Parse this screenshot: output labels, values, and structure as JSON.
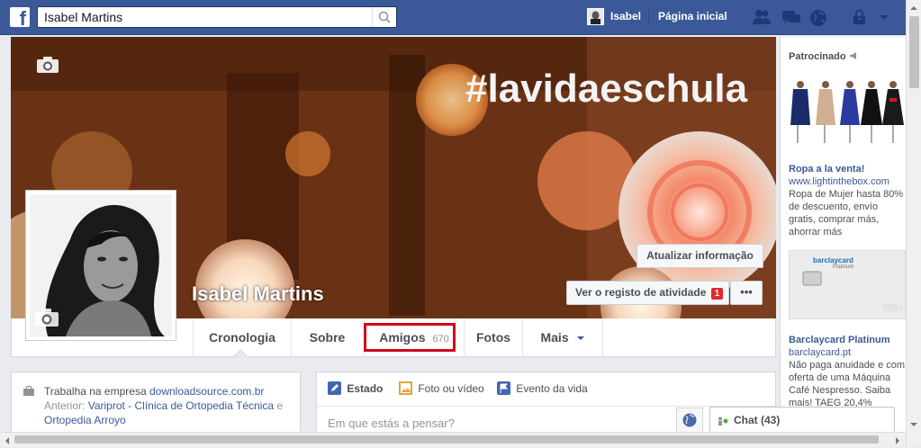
{
  "topbar": {
    "search_value": "Isabel Martins",
    "user_name": "Isabel",
    "home_label": "Página inicial",
    "icons": [
      "friend-requests-icon",
      "messages-icon",
      "notifications-globe-icon",
      "privacy-lock-icon",
      "account-dropdown-icon"
    ]
  },
  "cover": {
    "hashtag": "#lavidaeschula",
    "profile_name": "Isabel Martins",
    "update_info_label": "Atualizar informação",
    "activity_log_label": "Ver o registo de atividade",
    "activity_badge": "1",
    "more_label": "•••"
  },
  "tabs": [
    {
      "label": "Cronologia"
    },
    {
      "label": "Sobre"
    },
    {
      "label": "Amigos",
      "count": "670"
    },
    {
      "label": "Fotos"
    },
    {
      "label": "Mais"
    }
  ],
  "intro": {
    "work_prefix": "Trabalha na empresa",
    "work_company": "downloadsource.com.br",
    "previous_prefix": "Anterior:",
    "previous_1": "Variprot - Clínica de Ortopedia Técnica",
    "connector": "e",
    "previous_2": "Ortopedia Arroyo"
  },
  "composer": {
    "tab_status": "Estado",
    "tab_photo": "Foto ou vídeo",
    "tab_event": "Evento da vida",
    "placeholder": "Em que estás a pensar?"
  },
  "sponsored": {
    "header": "Patrocinado",
    "ads": [
      {
        "title": "Ropa a la venta!",
        "url": "www.lightinthebox.com",
        "text": "Ropa de Mujer hasta 80% de descuento, envío gratis, comprar más, ahorrar más"
      },
      {
        "title": "Barclaycard Platinum",
        "url": "barclaycard.pt",
        "text": "Não paga anuidade e com oferta de uma Máquina Café Nespresso. Saiba mais! TAEG 20,4%"
      }
    ],
    "card_brand": "barclaycard",
    "card_sub": "Platinum",
    "card_network": "VISA"
  },
  "chat": {
    "label": "Chat (43)"
  },
  "colors": {
    "brand": "#3b5998",
    "highlight_box": "#d0021b",
    "badge": "#e02a2a",
    "online": "#42b72a"
  }
}
